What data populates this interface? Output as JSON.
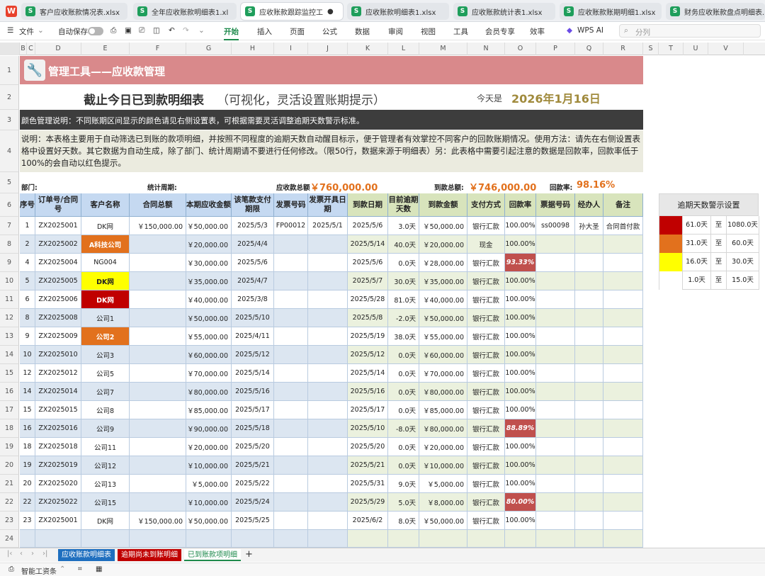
{
  "tabs": [
    {
      "label": "客户应收账款情况表.xlsx",
      "active": false
    },
    {
      "label": "全年应收账款明细表1.xl",
      "active": false
    },
    {
      "label": "应收账款跟踪监控工",
      "active": true
    },
    {
      "label": "应收账款明细表1.xlsx",
      "active": false
    },
    {
      "label": "应收账款统计表1.xlsx",
      "active": false
    },
    {
      "label": "应收账款账期明细1.xlsx",
      "active": false
    },
    {
      "label": "财务应收账款盘点明细表.",
      "active": false
    }
  ],
  "toolbar": {
    "file": "文件",
    "autosave": "自动保存",
    "menus": [
      "开始",
      "插入",
      "页面",
      "公式",
      "数据",
      "审阅",
      "视图",
      "工具",
      "会员专享",
      "效率"
    ],
    "wpsai": "WPS AI",
    "search_placeholder": "分列"
  },
  "columns": [
    "B",
    "C",
    "D",
    "E",
    "F",
    "G",
    "H",
    "I",
    "J",
    "K",
    "L",
    "M",
    "N",
    "O",
    "P",
    "Q",
    "R",
    "S",
    "T",
    "U",
    "V"
  ],
  "rows_numbers": [
    "1",
    "2",
    "3",
    "4",
    "5",
    "6",
    "7",
    "8",
    "9",
    "10",
    "11",
    "12",
    "13",
    "14",
    "15",
    "16",
    "17",
    "18",
    "19",
    "20",
    "21",
    "22",
    "23",
    "24"
  ],
  "title": "管理工具——应收款管理",
  "heading": {
    "main": "截止今日已到款明细表",
    "sub": "（可视化，灵活设置账期提示）",
    "today_label": "今天是",
    "today_value": "2026年1月16日"
  },
  "color_note": "颜色管理说明：不同账期区间显示的颜色请见右侧设置表，可根据需要灵活调整逾期天数警示标准。",
  "description": "说明：本表格主要用于自动筛选已到账的款项明细，并按照不同程度的逾期天数自动醒目标示，便于管理者有效掌控不同客户的回款账期情况。使用方法：请先在右侧设置表格中设置好天数。其它数据为自动生成，除了部门、统计周期请不要进行任何修改。（限50行，数据来源于明细表）另：此表格中需要引起注意的数据是回款率，回款率低于100%的会自动以红色提示。",
  "summary": {
    "dept_label": "部门:",
    "period_label": "统计周期:",
    "total_recv_label": "应收款总额",
    "total_recv_value": "￥760,000.00",
    "total_paid_label": "到款总额:",
    "total_paid_value": "￥746,000.00",
    "rate_label": "回款率:",
    "rate_value": "98.16%"
  },
  "headers": [
    "序号",
    "订单号/合同号",
    "客户名称",
    "合同总额",
    "本期应收金额",
    "该笔款支付期限",
    "发票号码",
    "发票开具日期",
    "到款日期",
    "目前逾期天数",
    "到款金额",
    "支付方式",
    "回款率",
    "票据号码",
    "经办人",
    "备注"
  ],
  "table": [
    {
      "seq": "1",
      "order": "ZX2025001",
      "client": "DK网",
      "clientColor": "",
      "contract": "￥150,000.00",
      "due_amt": "￥50,000.00",
      "due_date": "2025/5/3",
      "inv_no": "FP00012",
      "inv_date": "2025/5/1",
      "paid_date": "2025/5/6",
      "overdue": "3.0天",
      "paid_amt": "￥50,000.00",
      "method": "银行汇款",
      "rate": "100.00%",
      "rateRed": false,
      "bill": "ss00098",
      "handler": "孙大圣",
      "note": "合同首付款"
    },
    {
      "seq": "2",
      "order": "ZX2025002",
      "client": "A科技公司",
      "clientColor": "#e2711d",
      "contract": "",
      "due_amt": "￥20,000.00",
      "due_date": "2025/4/4",
      "inv_no": "",
      "inv_date": "",
      "paid_date": "2025/5/14",
      "overdue": "40.0天",
      "paid_amt": "￥20,000.00",
      "method": "现金",
      "rate": "100.00%",
      "rateRed": false,
      "bill": "",
      "handler": "",
      "note": ""
    },
    {
      "seq": "4",
      "order": "ZX2025004",
      "client": "NG004",
      "clientColor": "",
      "contract": "",
      "due_amt": "￥30,000.00",
      "due_date": "2025/5/6",
      "inv_no": "",
      "inv_date": "",
      "paid_date": "2025/5/6",
      "overdue": "0.0天",
      "paid_amt": "￥28,000.00",
      "method": "银行汇款",
      "rate": "93.33%",
      "rateRed": true,
      "bill": "",
      "handler": "",
      "note": ""
    },
    {
      "seq": "5",
      "order": "ZX2025005",
      "client": "DK网",
      "clientColor": "#ffff00",
      "contract": "",
      "due_amt": "￥35,000.00",
      "due_date": "2025/4/7",
      "inv_no": "",
      "inv_date": "",
      "paid_date": "2025/5/7",
      "overdue": "30.0天",
      "paid_amt": "￥35,000.00",
      "method": "银行汇款",
      "rate": "100.00%",
      "rateRed": false,
      "bill": "",
      "handler": "",
      "note": ""
    },
    {
      "seq": "6",
      "order": "ZX2025006",
      "client": "DK网",
      "clientColor": "#c00000",
      "contract": "",
      "due_amt": "￥40,000.00",
      "due_date": "2025/3/8",
      "inv_no": "",
      "inv_date": "",
      "paid_date": "2025/5/28",
      "overdue": "81.0天",
      "paid_amt": "￥40,000.00",
      "method": "银行汇款",
      "rate": "100.00%",
      "rateRed": false,
      "bill": "",
      "handler": "",
      "note": ""
    },
    {
      "seq": "8",
      "order": "ZX2025008",
      "client": "公司1",
      "clientColor": "",
      "contract": "",
      "due_amt": "￥50,000.00",
      "due_date": "2025/5/10",
      "inv_no": "",
      "inv_date": "",
      "paid_date": "2025/5/8",
      "overdue": "-2.0天",
      "paid_amt": "￥50,000.00",
      "method": "银行汇款",
      "rate": "100.00%",
      "rateRed": false,
      "bill": "",
      "handler": "",
      "note": ""
    },
    {
      "seq": "9",
      "order": "ZX2025009",
      "client": "公司2",
      "clientColor": "#e2711d",
      "contract": "",
      "due_amt": "￥55,000.00",
      "due_date": "2025/4/11",
      "inv_no": "",
      "inv_date": "",
      "paid_date": "2025/5/19",
      "overdue": "38.0天",
      "paid_amt": "￥55,000.00",
      "method": "银行汇款",
      "rate": "100.00%",
      "rateRed": false,
      "bill": "",
      "handler": "",
      "note": ""
    },
    {
      "seq": "10",
      "order": "ZX2025010",
      "client": "公司3",
      "clientColor": "",
      "contract": "",
      "due_amt": "￥60,000.00",
      "due_date": "2025/5/12",
      "inv_no": "",
      "inv_date": "",
      "paid_date": "2025/5/12",
      "overdue": "0.0天",
      "paid_amt": "￥60,000.00",
      "method": "银行汇款",
      "rate": "100.00%",
      "rateRed": false,
      "bill": "",
      "handler": "",
      "note": ""
    },
    {
      "seq": "12",
      "order": "ZX2025012",
      "client": "公司5",
      "clientColor": "",
      "contract": "",
      "due_amt": "￥70,000.00",
      "due_date": "2025/5/14",
      "inv_no": "",
      "inv_date": "",
      "paid_date": "2025/5/14",
      "overdue": "0.0天",
      "paid_amt": "￥70,000.00",
      "method": "银行汇款",
      "rate": "100.00%",
      "rateRed": false,
      "bill": "",
      "handler": "",
      "note": ""
    },
    {
      "seq": "14",
      "order": "ZX2025014",
      "client": "公司7",
      "clientColor": "",
      "contract": "",
      "due_amt": "￥80,000.00",
      "due_date": "2025/5/16",
      "inv_no": "",
      "inv_date": "",
      "paid_date": "2025/5/16",
      "overdue": "0.0天",
      "paid_amt": "￥80,000.00",
      "method": "银行汇款",
      "rate": "100.00%",
      "rateRed": false,
      "bill": "",
      "handler": "",
      "note": ""
    },
    {
      "seq": "15",
      "order": "ZX2025015",
      "client": "公司8",
      "clientColor": "",
      "contract": "",
      "due_amt": "￥85,000.00",
      "due_date": "2025/5/17",
      "inv_no": "",
      "inv_date": "",
      "paid_date": "2025/5/17",
      "overdue": "0.0天",
      "paid_amt": "￥85,000.00",
      "method": "银行汇款",
      "rate": "100.00%",
      "rateRed": false,
      "bill": "",
      "handler": "",
      "note": ""
    },
    {
      "seq": "16",
      "order": "ZX2025016",
      "client": "公司9",
      "clientColor": "",
      "contract": "",
      "due_amt": "￥90,000.00",
      "due_date": "2025/5/18",
      "inv_no": "",
      "inv_date": "",
      "paid_date": "2025/5/10",
      "overdue": "-8.0天",
      "paid_amt": "￥80,000.00",
      "method": "银行汇款",
      "rate": "88.89%",
      "rateRed": true,
      "bill": "",
      "handler": "",
      "note": ""
    },
    {
      "seq": "18",
      "order": "ZX2025018",
      "client": "公司11",
      "clientColor": "",
      "contract": "",
      "due_amt": "￥20,000.00",
      "due_date": "2025/5/20",
      "inv_no": "",
      "inv_date": "",
      "paid_date": "2025/5/20",
      "overdue": "0.0天",
      "paid_amt": "￥20,000.00",
      "method": "银行汇款",
      "rate": "100.00%",
      "rateRed": false,
      "bill": "",
      "handler": "",
      "note": ""
    },
    {
      "seq": "19",
      "order": "ZX2025019",
      "client": "公司12",
      "clientColor": "",
      "contract": "",
      "due_amt": "￥10,000.00",
      "due_date": "2025/5/21",
      "inv_no": "",
      "inv_date": "",
      "paid_date": "2025/5/21",
      "overdue": "0.0天",
      "paid_amt": "￥10,000.00",
      "method": "银行汇款",
      "rate": "100.00%",
      "rateRed": false,
      "bill": "",
      "handler": "",
      "note": ""
    },
    {
      "seq": "20",
      "order": "ZX2025020",
      "client": "公司13",
      "clientColor": "",
      "contract": "",
      "due_amt": "￥5,000.00",
      "due_date": "2025/5/22",
      "inv_no": "",
      "inv_date": "",
      "paid_date": "2025/5/31",
      "overdue": "9.0天",
      "paid_amt": "￥5,000.00",
      "method": "银行汇款",
      "rate": "100.00%",
      "rateRed": false,
      "bill": "",
      "handler": "",
      "note": ""
    },
    {
      "seq": "22",
      "order": "ZX2025022",
      "client": "公司15",
      "clientColor": "",
      "contract": "",
      "due_amt": "￥10,000.00",
      "due_date": "2025/5/24",
      "inv_no": "",
      "inv_date": "",
      "paid_date": "2025/5/29",
      "overdue": "5.0天",
      "paid_amt": "￥8,000.00",
      "method": "银行汇款",
      "rate": "80.00%",
      "rateRed": true,
      "bill": "",
      "handler": "",
      "note": ""
    },
    {
      "seq": "23",
      "order": "ZX2025001",
      "client": "DK网",
      "clientColor": "",
      "contract": "￥150,000.00",
      "due_amt": "￥50,000.00",
      "due_date": "2025/5/25",
      "inv_no": "",
      "inv_date": "",
      "paid_date": "2025/6/2",
      "overdue": "8.0天",
      "paid_amt": "￥50,000.00",
      "method": "银行汇款",
      "rate": "100.00%",
      "rateRed": false,
      "bill": "",
      "handler": "",
      "note": ""
    }
  ],
  "legend": {
    "title": "逾期天数警示设置",
    "to": "至",
    "rows": [
      {
        "color": "#c00000",
        "from": "61.0天",
        "to_val": "1080.0天"
      },
      {
        "color": "#e2711d",
        "from": "31.0天",
        "to_val": "60.0天"
      },
      {
        "color": "#ffff00",
        "from": "16.0天",
        "to_val": "30.0天"
      },
      {
        "color": "#ffffff",
        "from": "1.0天",
        "to_val": "15.0天"
      }
    ]
  },
  "sheets": [
    {
      "label": "应收账款明细表",
      "color": "#1f6fbf"
    },
    {
      "label": "逾期尚未到账明细",
      "color": "#c00000"
    },
    {
      "label": "已到账款项明细",
      "color": "active"
    }
  ],
  "status": {
    "assistant": "智能工资条"
  }
}
